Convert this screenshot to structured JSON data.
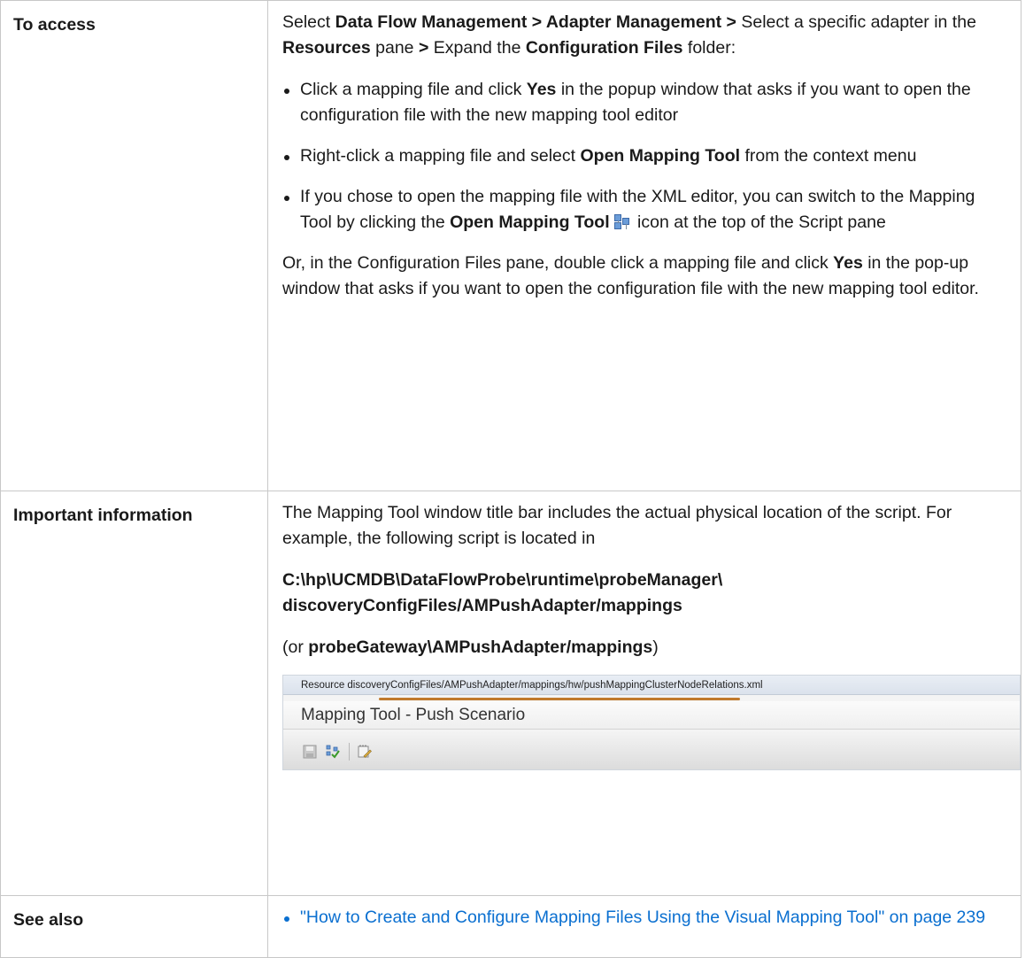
{
  "rows": {
    "access": {
      "label": "To access",
      "intro": {
        "p1": "Select ",
        "b1": "Data Flow Management > Adapter Management >",
        "p2": "  Select a specific adapter in the ",
        "b2": "Resources",
        "p3": " pane ",
        "b3": ">",
        "p4": " Expand the ",
        "b4": "Configuration Files",
        "p5": " folder:"
      },
      "bullets": [
        {
          "pre": "Click a mapping file and click ",
          "bold": "Yes",
          "post": " in the popup window that asks if you want to open the configuration file with the new mapping tool editor"
        },
        {
          "pre": "Right-click a mapping file and select ",
          "bold": "Open Mapping Tool",
          "post": " from the context menu"
        },
        {
          "pre": "If you chose to open the mapping file with the XML editor, you can switch to the Mapping Tool by clicking the ",
          "bold": "Open Mapping Tool",
          "post": " icon at the top of the Script pane",
          "icon": "mapping-tool-icon"
        }
      ],
      "outro": {
        "pre": "Or, in the Configuration Files pane, double click a mapping file and click ",
        "bold": "Yes",
        "post": " in the pop-up window that asks if you want to open the configuration file with the new mapping tool editor."
      }
    },
    "important": {
      "label": "Important information",
      "p1": "The Mapping Tool window title bar includes the actual physical location of the script. For example, the following script is located in",
      "path_line1": "C:\\hp\\UCMDB\\DataFlowProbe\\runtime\\probeManager\\",
      "path_line2": "discoveryConfigFiles/AMPushAdapter/mappings",
      "alt": {
        "pre": "(or ",
        "bold": "probeGateway\\AMPushAdapter/mappings",
        "post": ")"
      },
      "screenshot": {
        "resource_bar": "Resource discoveryConfigFiles/AMPushAdapter/mappings/hw/pushMappingClusterNodeRelations.xml",
        "window_title": "Mapping Tool - Push Scenario",
        "toolbar_icons": [
          "save-icon",
          "validate-mapping-icon",
          "edit-icon"
        ],
        "highlight_color": "#c07a2c"
      }
    },
    "see_also": {
      "label": "See also",
      "links": [
        {
          "text": "\"How to Create and Configure Mapping Files Using the Visual Mapping Tool\" on page 239"
        }
      ]
    }
  },
  "colors": {
    "link": "#0a6fd0",
    "border": "#c8c8c8"
  }
}
